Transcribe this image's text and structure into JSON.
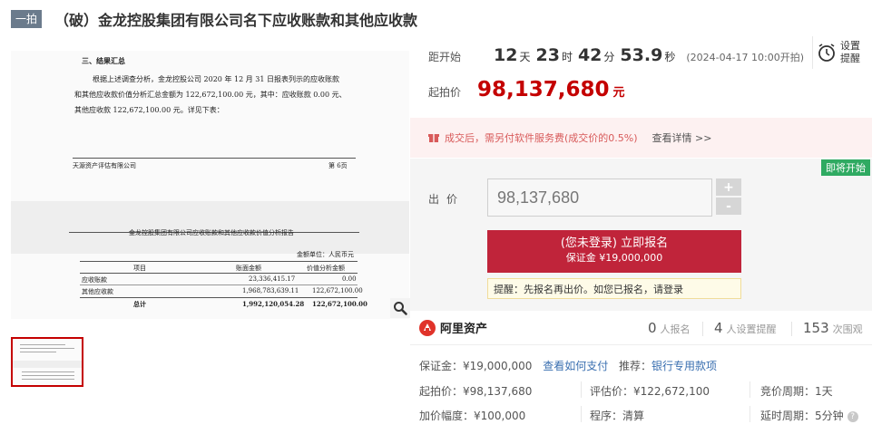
{
  "title": {
    "tag": "一拍",
    "text": "（破）金龙控股集团有限公司名下应收账款和其他应收款"
  },
  "document_preview": {
    "page1": {
      "heading": "三、结果汇总",
      "lines": [
        "根据上述调查分析，金龙控股公司 2020 年 12 月 31 日报表列示的应收账款",
        "和其他应收款价值分析汇总金额为 122,672,100.00 元，其中：应收账款 0.00 元、",
        "其他应收款 122,672,100.00 元。详见下表："
      ],
      "footer_left": "天源资产评估有限公司",
      "footer_right": "第 6页"
    },
    "page2": {
      "heading": "金龙控股集团有限公司应收账款和其他应收款价值分析报告",
      "unit": "金额单位：人民币元",
      "columns": [
        "项目",
        "账面金额",
        "价值分析金额"
      ],
      "rows": [
        [
          "应收账款",
          "23,336,415.17",
          "0.00"
        ],
        [
          "其他应收款",
          "1,968,783,639.11",
          "122,672,100.00"
        ],
        [
          "总计",
          "1,992,120,054.28",
          "122,672,100.00"
        ]
      ]
    }
  },
  "countdown": {
    "label": "距开始",
    "days": "12",
    "days_unit": "天",
    "hours": "23",
    "hours_unit": "时",
    "minutes": "42",
    "minutes_unit": "分",
    "seconds": "53.9",
    "seconds_unit": "秒",
    "start_time": "(2024-04-17 10:00开拍)"
  },
  "reminder": {
    "label": "设置提醒"
  },
  "start_price": {
    "label": "起拍价",
    "value": "98,137,680",
    "unit": "元"
  },
  "fee_notice": {
    "text": "成交后，需另付软件服务费(成交价的0.5%)",
    "link": "查看详情 >>"
  },
  "bid": {
    "badge": "即将开始",
    "label": "出价",
    "value": "98,137,680",
    "plus": "+",
    "minus": "-",
    "register_main": "(您未登录) 立即报名",
    "register_sub": "保证金 ¥19,000,000",
    "tip_prefix": "提醒：先报名再出价。如您已报名，请",
    "tip_link": "登录"
  },
  "platform": {
    "name": "阿里资产",
    "stats": [
      {
        "num": "0",
        "label": "人报名"
      },
      {
        "num": "4",
        "label": "人设置提醒"
      },
      {
        "num": "153",
        "label": "次围观"
      }
    ]
  },
  "info": {
    "deposit_label": "保证金：",
    "deposit_value": "¥19,000,000",
    "pay_link": "查看如何支付",
    "recommend_label": "推荐：",
    "recommend_link": "银行专用款项",
    "start_price_label": "起拍价：",
    "start_price_value": "¥98,137,680",
    "eval_label": "评估价：",
    "eval_value": "¥122,672,100",
    "cycle_label": "竞价周期：",
    "cycle_value": "1天",
    "increment_label": "加价幅度：",
    "increment_value": "¥100,000",
    "procedure_label": "程序：",
    "procedure_value": "清算",
    "delay_label": "延时周期：",
    "delay_value": "5分钟"
  },
  "colors": {
    "accent_red": "#c40000",
    "button_red": "#c0243a",
    "badge_green": "#2faa62",
    "link_blue": "#3a6fb0"
  }
}
